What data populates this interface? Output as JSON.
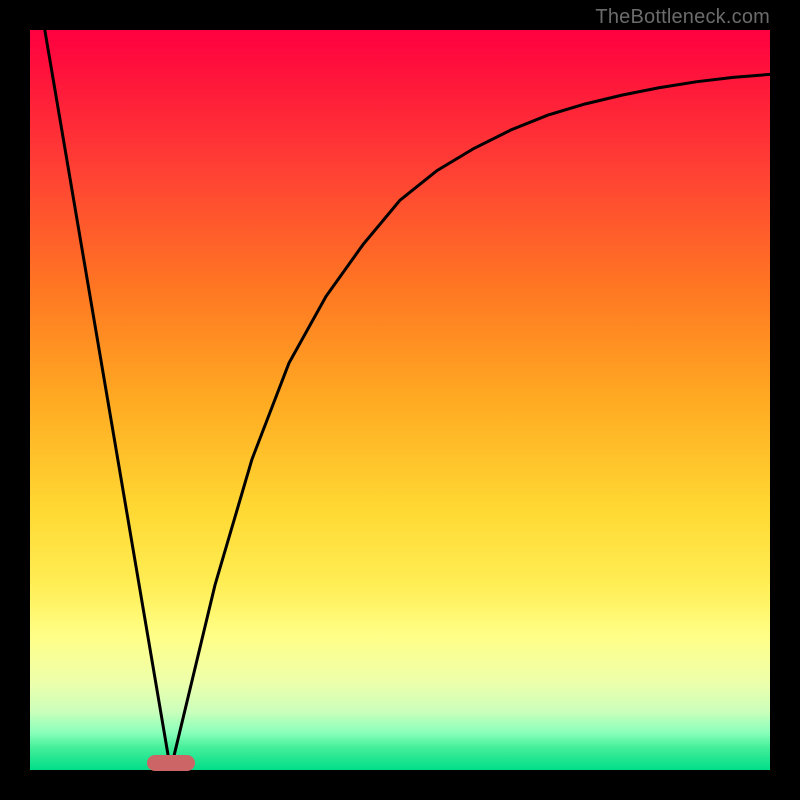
{
  "watermark": "TheBottleneck.com",
  "chart_data": {
    "type": "line",
    "title": "",
    "xlabel": "",
    "ylabel": "",
    "xlim": [
      0,
      100
    ],
    "ylim": [
      0,
      100
    ],
    "grid": false,
    "legend": false,
    "background_gradient": {
      "top": "#ff0040",
      "middle": "#ffee55",
      "bottom": "#00dd88"
    },
    "series": [
      {
        "name": "left-line",
        "type": "line",
        "x": [
          2,
          19
        ],
        "y": [
          100,
          0
        ]
      },
      {
        "name": "right-curve",
        "type": "line",
        "x": [
          19,
          25,
          30,
          35,
          40,
          45,
          50,
          55,
          60,
          65,
          70,
          75,
          80,
          85,
          90,
          95,
          100
        ],
        "y": [
          0,
          25,
          42,
          55,
          64,
          71,
          77,
          81,
          84,
          86.5,
          88.5,
          90,
          91.2,
          92.2,
          93,
          93.6,
          94
        ]
      }
    ],
    "marker": {
      "x_center": 19,
      "width_pct": 6.5,
      "color": "#cc6666",
      "shape": "rounded-bar"
    }
  }
}
